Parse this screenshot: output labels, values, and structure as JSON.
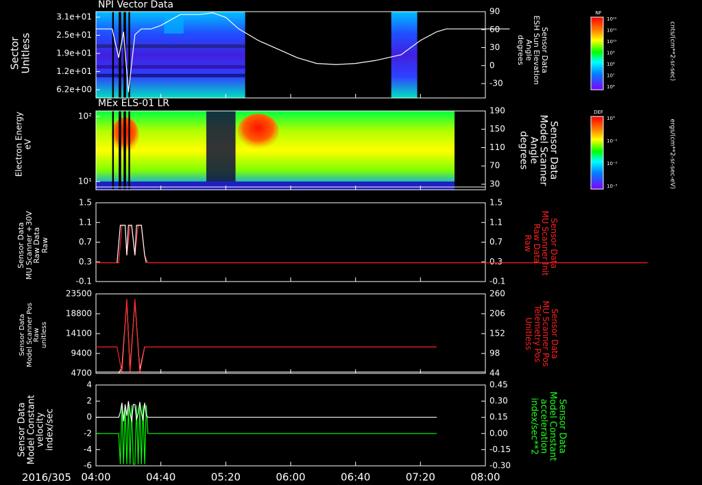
{
  "date_label": "2016/305",
  "x_ticks": [
    "04:00",
    "04:40",
    "05:20",
    "06:00",
    "06:40",
    "07:20",
    "08:00"
  ],
  "colorbars": [
    {
      "label": "NF",
      "unit": "cnts/(cm**2-sr-sec)",
      "ticks": [
        "10¹²",
        "10¹¹",
        "10¹⁰",
        "10⁹",
        "10⁸",
        "10⁷",
        "10⁶"
      ]
    },
    {
      "label": "DEF",
      "unit": "ergs/(cm**2-sr-sec-eV)",
      "ticks": [
        "10°",
        "10⁻¹",
        "10⁻²",
        "10⁻³"
      ]
    }
  ],
  "colors": {
    "white": "#ffffff",
    "red": "#ff0000",
    "green": "#00ff00",
    "axis": "#ffffff"
  },
  "chart_data": [
    {
      "type": "heatmap",
      "title": "NPI Vector Data",
      "ylabel": "Sector\nUnitless",
      "yticks": [
        "3.1e+01",
        "2.5e+01",
        "1.9e+01",
        "1.2e+01",
        "6.2e+00"
      ],
      "y2label": "Sensor Data\nESH Sun Elevation\nAngle\ndegrees",
      "y2ticks": [
        "90",
        "60",
        "30",
        "0",
        "-30"
      ],
      "y2lim": [
        -60,
        90
      ],
      "overlay_series": {
        "x_minutes": [
          0,
          10,
          14,
          17,
          20,
          24,
          28,
          34,
          40,
          52,
          64,
          72,
          80,
          88,
          100,
          112,
          124,
          136,
          148,
          160,
          172,
          188,
          200,
          210,
          216,
          220,
          232,
          240,
          247,
          255
        ],
        "values": [
          60,
          60,
          10,
          55,
          -50,
          50,
          60,
          60,
          66,
          85,
          85,
          88,
          80,
          60,
          40,
          25,
          10,
          0,
          -2,
          0,
          5,
          15,
          40,
          55,
          60,
          60,
          60,
          60,
          60,
          60
        ]
      }
    },
    {
      "type": "heatmap",
      "title": "MEx ELS-01 LR",
      "ylabel": "Electron Energy\neV",
      "yticks": [
        "10²",
        "10¹"
      ],
      "y2label": "Sensor Data\nModel Scanner\nAngle\ndegrees",
      "y2ticks": [
        "190",
        "150",
        "110",
        "70",
        "30"
      ],
      "y2lim": [
        0,
        190
      ]
    },
    {
      "type": "line",
      "ylabel": "Sensor Data\nMU Scanner +30V\nRaw Data\nRaw",
      "yticks": [
        "1.5",
        "1.1",
        "0.7",
        "0.3",
        "-0.1"
      ],
      "ylim": [
        -0.5,
        1.5
      ],
      "y2label": "Sensor Data\nMU Scanner Init\nRaw Data\nRaw",
      "y2ticks": [
        "1.5",
        "1.1",
        "0.7",
        "0.3",
        "-0.1"
      ],
      "series": [
        {
          "x_minutes": [
            0,
            12,
            14,
            16,
            18,
            19,
            21,
            22,
            24,
            26,
            28,
            30,
            32,
            340
          ],
          "values": [
            0,
            0,
            0,
            1,
            1,
            0.2,
            1,
            1,
            0.2,
            1,
            1,
            0.2,
            0,
            0
          ]
        }
      ]
    },
    {
      "type": "line",
      "ylabel": "Sensor Data\nModel Scanner Pos\nRaw\nunitless",
      "yticks": [
        "23500",
        "18800",
        "14100",
        "9400",
        "4700"
      ],
      "ylim": [
        0,
        23500
      ],
      "y2label": "Sensor Data\nMU Scanner Pos\nTelemetry Pos\nUnitless",
      "y2ticks": [
        "260",
        "206",
        "152",
        "98",
        "44"
      ],
      "series": [
        {
          "x_minutes": [
            0,
            13,
            16,
            19,
            21,
            24,
            27,
            30,
            33,
            210
          ],
          "values": [
            7800,
            7800,
            0,
            22000,
            0,
            22000,
            0,
            7800,
            7800,
            7800
          ]
        },
        {
          "x_minutes": [
            14,
            16,
            19,
            21,
            24,
            27,
            30
          ],
          "values": [
            0,
            1800,
            21500,
            1000,
            21500,
            1000,
            7800
          ]
        }
      ]
    },
    {
      "type": "line",
      "ylabel": "Sensor Data\nModel Constant\nvelocity\nindex/sec",
      "yticks": [
        "4",
        "2",
        "0",
        "-2",
        "-4",
        "-6"
      ],
      "ylim": [
        -6,
        4
      ],
      "y2label": "Sensor Data\nModel Constant\nacceleration\nindex/sec**2",
      "y2ticks": [
        "0.45",
        "0.30",
        "0.15",
        "0.00",
        "-0.15",
        "-0.30"
      ],
      "series": [
        {
          "x_minutes": [
            0,
            13,
            14,
            15,
            16,
            17,
            18,
            19,
            20,
            21,
            22,
            23,
            24,
            25,
            26,
            27,
            28,
            29,
            30,
            31,
            32,
            33,
            34,
            210
          ],
          "values": [
            0,
            0,
            0,
            0.6,
            1.8,
            -0.5,
            1.6,
            0.2,
            2,
            0.5,
            -0.5,
            1.6,
            1.6,
            -0.3,
            0.5,
            1.9,
            0.6,
            -0.4,
            1.8,
            0.3,
            0,
            0,
            0,
            0
          ]
        },
        {
          "x_minutes": [
            0,
            14,
            15,
            16,
            17,
            18,
            19,
            20,
            21,
            22,
            23,
            24,
            25,
            26,
            27,
            28,
            29,
            30,
            31,
            32,
            210
          ],
          "values": [
            -2,
            -2,
            -5.8,
            1.5,
            -5.8,
            1.5,
            -5.8,
            1.5,
            -5.8,
            1.5,
            -5.8,
            -5.8,
            1.5,
            -5.8,
            1.5,
            -5.8,
            1.5,
            -5.8,
            1.5,
            -2,
            -2
          ]
        }
      ]
    }
  ]
}
